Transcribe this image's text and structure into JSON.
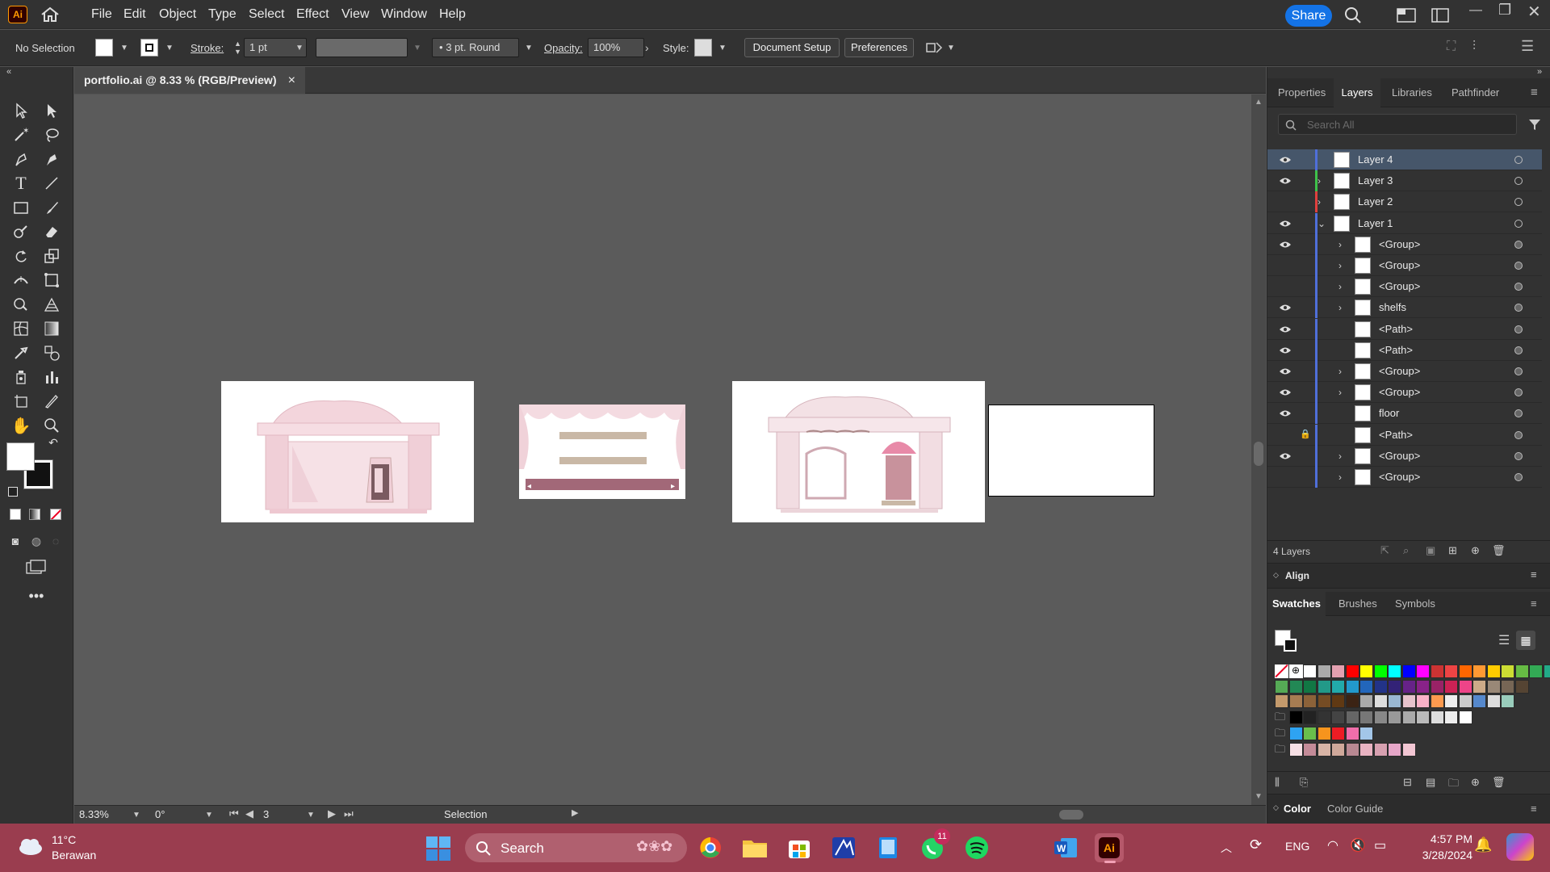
{
  "menubar": {
    "logo": "Ai",
    "items": [
      "File",
      "Edit",
      "Object",
      "Type",
      "Select",
      "Effect",
      "View",
      "Window",
      "Help"
    ],
    "share": "Share"
  },
  "control": {
    "selection": "No Selection",
    "stroke_label": "Stroke:",
    "stroke_value": "1 pt",
    "brush": "3 pt. Round",
    "opacity_label": "Opacity:",
    "opacity_value": "100%",
    "style_label": "Style:",
    "doc_setup": "Document Setup",
    "preferences": "Preferences"
  },
  "document": {
    "tab_title": "portfolio.ai @ 8.33 % (RGB/Preview)",
    "close": "×"
  },
  "status": {
    "zoom": "8.33%",
    "rotation": "0°",
    "artboard": "3",
    "tool": "Selection"
  },
  "panels": {
    "tabs": [
      "Properties",
      "Layers",
      "Libraries",
      "Pathfinder"
    ],
    "active_tab": "Layers",
    "search_placeholder": "Search All",
    "layer_count": "4 Layers",
    "align_title": "Align",
    "swatch_tabs": [
      "Swatches",
      "Brushes",
      "Symbols"
    ],
    "color_tabs": [
      "Color",
      "Color Guide"
    ]
  },
  "layers": [
    {
      "name": "Layer 4",
      "visible": true,
      "color": "#4f6fd9",
      "expand": "",
      "indent": 0,
      "selected": true
    },
    {
      "name": "Layer 3",
      "visible": true,
      "color": "#3ec14a",
      "expand": "›",
      "indent": 0
    },
    {
      "name": "Layer 2",
      "visible": false,
      "color": "#e0403e",
      "expand": "›",
      "indent": 0
    },
    {
      "name": "Layer 1",
      "visible": true,
      "color": "#4f6fd9",
      "expand": "⌄",
      "indent": 0
    },
    {
      "name": "<Group>",
      "visible": true,
      "color": "#4f6fd9",
      "expand": "›",
      "indent": 1
    },
    {
      "name": "<Group>",
      "visible": false,
      "color": "#4f6fd9",
      "expand": "›",
      "indent": 1
    },
    {
      "name": "<Group>",
      "visible": false,
      "color": "#4f6fd9",
      "expand": "›",
      "indent": 1
    },
    {
      "name": "shelfs",
      "visible": true,
      "color": "#4f6fd9",
      "expand": "›",
      "indent": 1
    },
    {
      "name": "<Path>",
      "visible": true,
      "color": "#4f6fd9",
      "expand": "",
      "indent": 1
    },
    {
      "name": "<Path>",
      "visible": true,
      "color": "#4f6fd9",
      "expand": "",
      "indent": 1
    },
    {
      "name": "<Group>",
      "visible": true,
      "color": "#4f6fd9",
      "expand": "›",
      "indent": 1
    },
    {
      "name": "<Group>",
      "visible": true,
      "color": "#4f6fd9",
      "expand": "›",
      "indent": 1
    },
    {
      "name": "floor",
      "visible": true,
      "color": "#4f6fd9",
      "expand": "",
      "indent": 1
    },
    {
      "name": "<Path>",
      "visible": false,
      "locked": true,
      "color": "#4f6fd9",
      "expand": "",
      "indent": 1
    },
    {
      "name": "<Group>",
      "visible": true,
      "color": "#4f6fd9",
      "expand": "›",
      "indent": 1
    },
    {
      "name": "<Group>",
      "visible": false,
      "color": "#4f6fd9",
      "expand": "›",
      "indent": 1
    }
  ],
  "taskbar": {
    "weather_temp": "11°C",
    "weather_desc": "Berawan",
    "search": "Search",
    "lang": "ENG",
    "time": "4:57 PM",
    "date": "3/28/2024",
    "whatsapp_badge": "11",
    "ai_label": "Ai"
  }
}
